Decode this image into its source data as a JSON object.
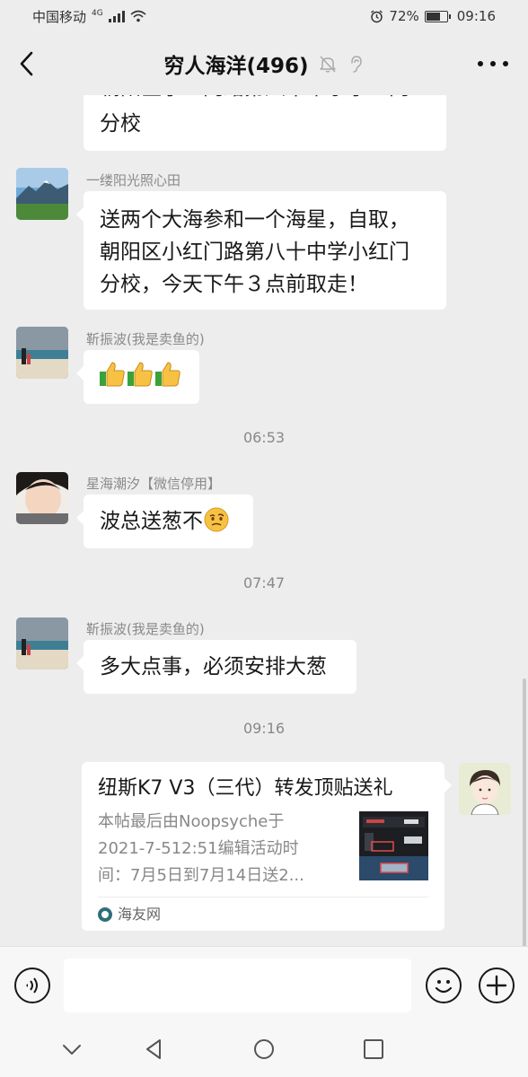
{
  "status_bar": {
    "carrier": "中国移动",
    "network": "4G",
    "alarm_icon": "alarm-icon",
    "battery_percent": "72%",
    "battery_level": 0.72,
    "time": "09:16"
  },
  "header": {
    "title": "穷人海洋(496)",
    "back_icon": "chevron-left-icon",
    "mute_icon": "bell-off-icon",
    "earpiece_icon": "ear-icon",
    "more_icon": "more-horizontal-icon"
  },
  "messages": [
    {
      "text_line1": "朝阳区小红门路第八十中学小红门",
      "text_line2": "分校"
    },
    {
      "sender": "一缕阳光照心田",
      "line1": "送两个大海参和一个海星，自取，",
      "line2": "朝阳区小红门路第八十中学小红门",
      "line3": "分校，今天下午３点前取走！"
    },
    {
      "sender": "靳振波(我是卖鱼的)",
      "content": "thumbs-up-x3",
      "emoji_icon": "thumbs-up-icon"
    },
    {
      "timestamp": "06:53"
    },
    {
      "sender": "星海潮汐【微信停用】",
      "text": "波总送葱不",
      "emoji_icon": "thinking-face-icon"
    },
    {
      "timestamp": "07:47"
    },
    {
      "sender": "靳振波(我是卖鱼的)",
      "text": "多大点事，必须安排大葱"
    },
    {
      "timestamp": "09:16"
    }
  ],
  "link_card": {
    "title": "纽斯K7 V3（三代）转发顶贴送礼",
    "desc_line1": "本帖最后由Noopsyche于",
    "desc_line2": "2021-7-512:51编辑活动时",
    "desc_line3": "间：7月5日到7月14日送2...",
    "source": "海友网",
    "source_icon": "site-logo-icon"
  },
  "input_bar": {
    "voice_icon": "voice-icon",
    "input_value": "",
    "emoji_icon": "smile-icon",
    "plus_icon": "plus-icon"
  },
  "nav_bar": {
    "collapse_icon": "chevron-down-icon",
    "back_icon": "triangle-back-icon",
    "home_icon": "circle-home-icon",
    "recents_icon": "square-recents-icon"
  },
  "colors": {
    "chat_background": "#ededed",
    "bubble_left": "#ffffff",
    "timestamp_text": "#888888",
    "nickname_text": "#8a8a8a"
  }
}
